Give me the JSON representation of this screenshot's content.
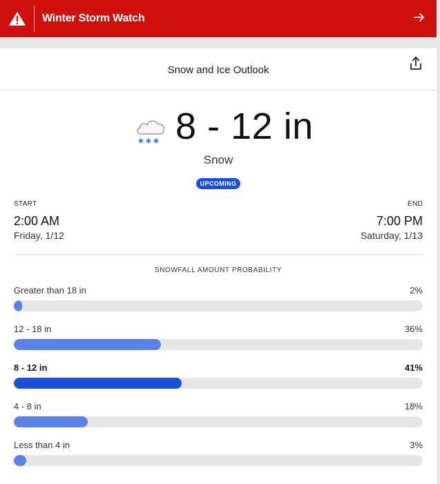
{
  "alert": {
    "title": "Winter Storm Watch",
    "color": "#d00f0f",
    "icon": "warning-triangle-icon",
    "action_icon": "arrow-right-icon"
  },
  "card": {
    "title": "Snow and Ice Outlook",
    "share_icon": "share-icon"
  },
  "forecast": {
    "icon": "snow-cloud-icon",
    "amount": "8 - 12 in",
    "precip_type": "Snow",
    "status_badge": "UPCOMING",
    "badge_color": "#1b4fd8"
  },
  "timing": {
    "start_label": "START",
    "start_time": "2:00 AM",
    "start_date": "Friday, 1/12",
    "end_label": "END",
    "end_time": "7:00 PM",
    "end_date": "Saturday, 1/13"
  },
  "probability": {
    "title": "SNOWFALL AMOUNT PROBABILITY",
    "rows": [
      {
        "label": "Greater than 18 in",
        "percent": "2%",
        "value": 2,
        "highlighted": false
      },
      {
        "label": "12 - 18 in",
        "percent": "36%",
        "value": 36,
        "highlighted": false
      },
      {
        "label": "8 - 12 in",
        "percent": "41%",
        "value": 41,
        "highlighted": true
      },
      {
        "label": "4 - 8 in",
        "percent": "18%",
        "value": 18,
        "highlighted": false
      },
      {
        "label": "Less than 4 in",
        "percent": "3%",
        "value": 3,
        "highlighted": false
      }
    ]
  }
}
